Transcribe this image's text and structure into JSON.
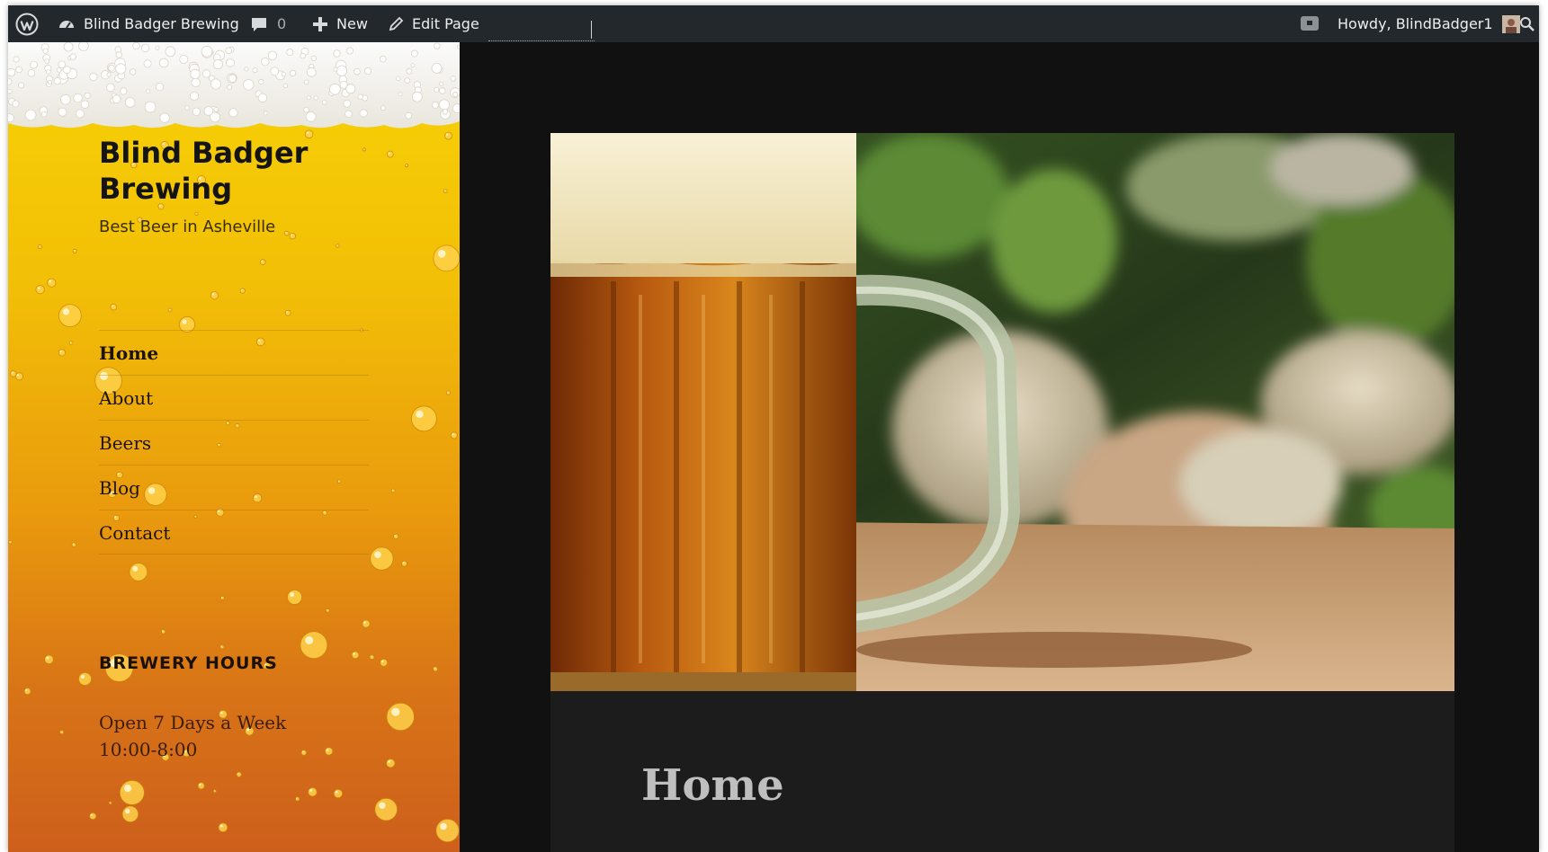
{
  "admin_bar": {
    "site_name": "Blind Badger Brewing",
    "comments_count": "0",
    "new_label": "New",
    "edit_label": "Edit Page",
    "greeting": "Howdy, BlindBadger1"
  },
  "site": {
    "title": "Blind Badger Brewing",
    "tagline": "Best Beer in Asheville"
  },
  "nav": {
    "items": [
      {
        "label": "Home"
      },
      {
        "label": "About"
      },
      {
        "label": "Beers"
      },
      {
        "label": "Blog"
      },
      {
        "label": "Contact"
      }
    ]
  },
  "widget": {
    "title": "BREWERY HOURS",
    "line1": "Open 7 Days a Week",
    "line2": "10:00-8:00"
  },
  "page": {
    "title": "Home"
  },
  "colors": {
    "admin_bar": "#23282d",
    "page_bg": "#111111",
    "content_bg": "#1c1c1c",
    "beer_gold": "#f7d205",
    "beer_amber": "#cd5f1c"
  }
}
